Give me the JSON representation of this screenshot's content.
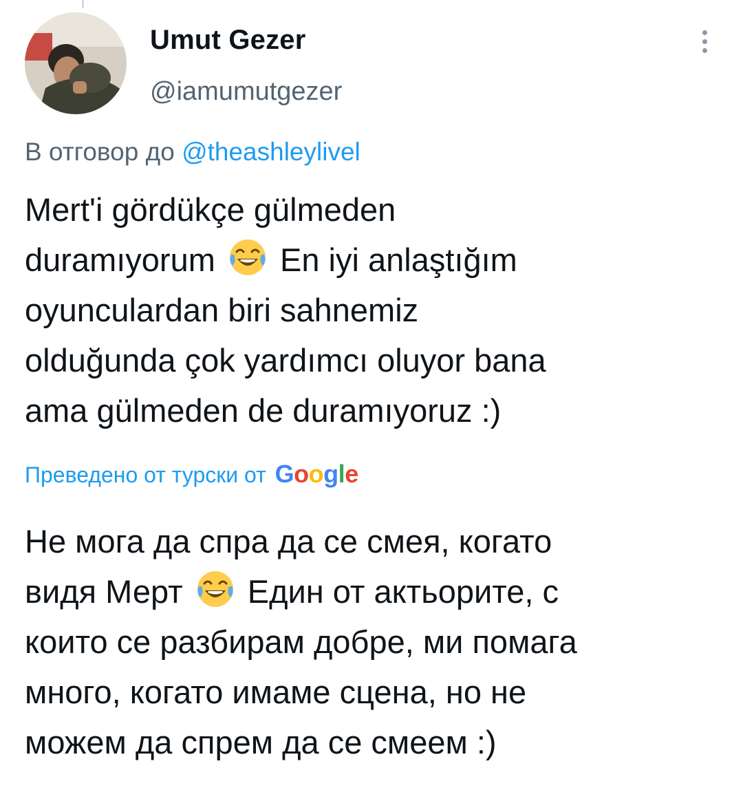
{
  "tweet": {
    "author": {
      "display_name": "Umut Gezer",
      "handle": "@iamumutgezer"
    },
    "reply_to": {
      "prefix": "В отговор до ",
      "mention": "@theashleylivel"
    },
    "text_lines": [
      "Mert'i gördükçe gülmeden",
      "duramıyorum",
      "En iyi anlaştığım",
      "oyunculardan biri sahnemiz",
      "olduğunda çok yardımcı oluyor bana",
      "ama gülmeden de duramıyoruz :)"
    ],
    "translation": {
      "label": "Преведено от турски от ",
      "provider_letters": [
        "G",
        "o",
        "o",
        "g",
        "l",
        "e"
      ]
    },
    "translated_lines": [
      "Не мога да спра да се смея, когато",
      "видя Мерт",
      "Един от актьорите, с",
      "които се разбирам добре, ми помага",
      "много, когато имаме сцена, но не",
      "можем да спрем да се смеем :)"
    ],
    "emoji_icon": "face-with-tears-of-joy-icon",
    "more_icon": "more-options-vertical-icon"
  }
}
